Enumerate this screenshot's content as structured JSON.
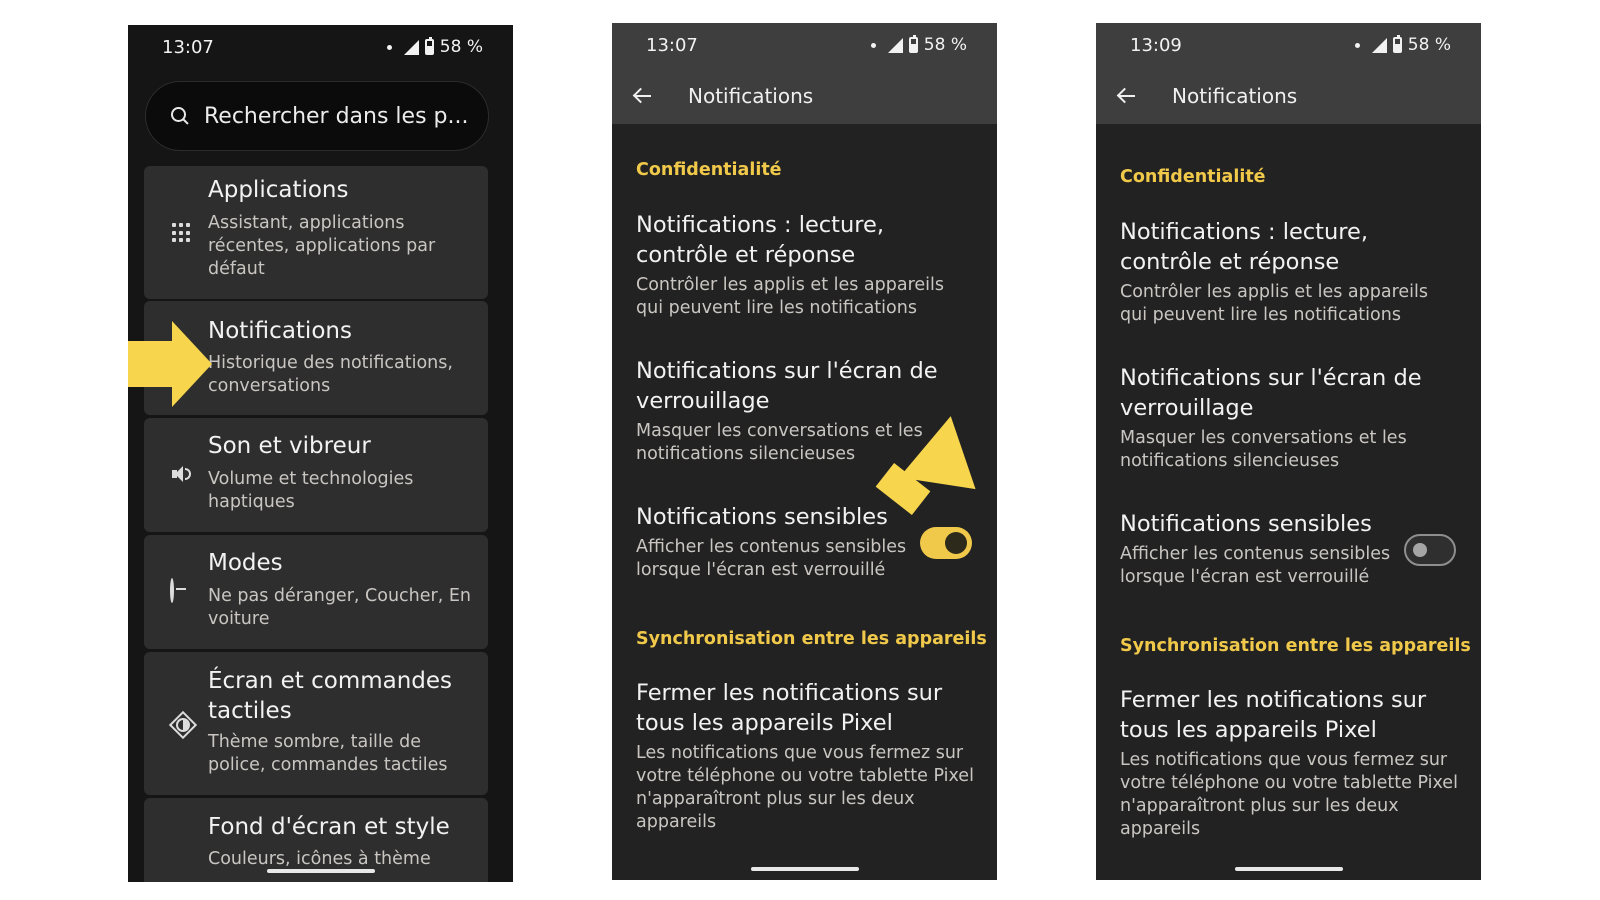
{
  "phone1": {
    "status": {
      "time": "13:07",
      "battery": "58 %"
    },
    "search": {
      "placeholder": "Rechercher dans les p..."
    },
    "items": [
      {
        "title": "Applications",
        "subtitle": "Assistant, applications récentes, applications par défaut",
        "icon": "apps-grid-icon"
      },
      {
        "title": "Notifications",
        "subtitle": "Historique des notifications, conversations",
        "icon": "bell-icon"
      },
      {
        "title": "Son et vibreur",
        "subtitle": "Volume et technologies haptiques",
        "icon": "speaker-icon"
      },
      {
        "title": "Modes",
        "subtitle": "Ne pas déranger, Coucher, En voiture",
        "icon": "do-not-disturb-icon"
      },
      {
        "title": "Écran et commandes tactiles",
        "subtitle": "Thème sombre, taille de police, commandes tactiles",
        "icon": "brightness-icon"
      },
      {
        "title": "Fond d'écran et style",
        "subtitle": "Couleurs, icônes à thème",
        "icon": "palette-icon"
      }
    ]
  },
  "phone2": {
    "status": {
      "time": "13:07",
      "battery": "58 %"
    },
    "appbar": {
      "title": "Notifications"
    },
    "sections": [
      {
        "header": "Confidentialité"
      },
      {
        "header": "Synchronisation entre les appareils"
      }
    ],
    "items": [
      {
        "title": "Notifications : lecture, contrôle et réponse",
        "subtitle": "Contrôler les applis et les appareils qui peuvent lire les notifications"
      },
      {
        "title": "Notifications sur l'écran de verrouillage",
        "subtitle": "Masquer les conversations et les notifications silencieuses"
      },
      {
        "title": "Notifications sensibles",
        "subtitle": "Afficher les contenus sensibles lorsque l'écran est verrouillé",
        "toggle": true
      },
      {
        "title": "Fermer les notifications sur tous les appareils Pixel",
        "subtitle": "Les notifications que vous fermez sur votre téléphone ou votre tablette Pixel n'apparaîtront plus sur les deux appareils"
      }
    ]
  },
  "phone3": {
    "status": {
      "time": "13:09",
      "battery": "58 %"
    },
    "appbar": {
      "title": "Notifications"
    },
    "sections": [
      {
        "header": "Confidentialité"
      },
      {
        "header": "Synchronisation entre les appareils"
      }
    ],
    "items": [
      {
        "title": "Notifications : lecture, contrôle et réponse",
        "subtitle": "Contrôler les applis et les appareils qui peuvent lire les notifications"
      },
      {
        "title": "Notifications sur l'écran de verrouillage",
        "subtitle": "Masquer les conversations et les notifications silencieuses"
      },
      {
        "title": "Notifications sensibles",
        "subtitle": "Afficher les contenus sensibles lorsque l'écran est verrouillé",
        "toggle": false
      },
      {
        "title": "Fermer les notifications sur tous les appareils Pixel",
        "subtitle": "Les notifications que vous fermez sur votre téléphone ou votre tablette Pixel n'apparaîtront plus sur les deux appareils"
      }
    ]
  },
  "colors": {
    "accent": "#f1c94a",
    "highlight_arrow": "#f7d54d",
    "card": "#2e2e2e",
    "appbar": "#3e3e3e"
  }
}
